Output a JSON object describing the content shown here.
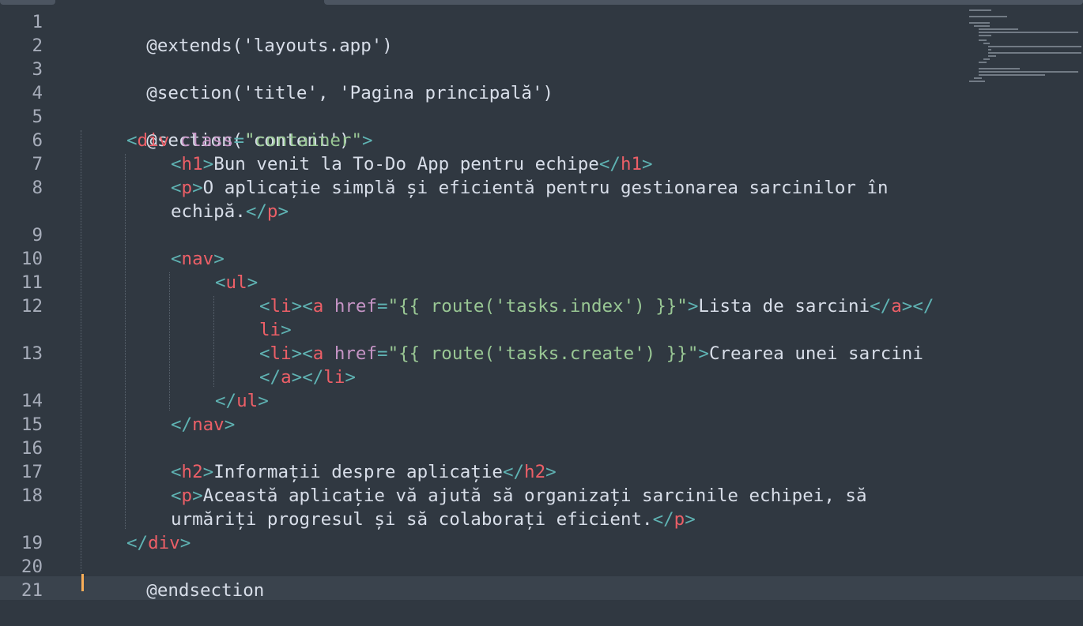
{
  "editor": {
    "line_numbers": [
      "1",
      "2",
      "3",
      "4",
      "5",
      "6",
      "7",
      "8",
      "9",
      "10",
      "11",
      "12",
      "13",
      "14",
      "15",
      "16",
      "17",
      "18",
      "19",
      "20",
      "21"
    ],
    "code": {
      "l1": "@extends('layouts.app')",
      "l3": "@section('title', 'Pagina principală')",
      "l5": "@section('content')",
      "l20": "@endsection"
    },
    "tokens": {
      "lt": "<",
      "gt": ">",
      "lt_slash": "</",
      "eq": "=",
      "div": "div",
      "class": "class",
      "container": "\"container\"",
      "h1": "h1",
      "h1_text": "Bun venit la To-Do App pentru echipe",
      "p": "p",
      "p1_text_a": "O aplicație simplă și eficientă pentru gestionarea sarcinilor în",
      "p1_text_b": "echipă.",
      "nav": "nav",
      "ul": "ul",
      "li": "li",
      "a": "a",
      "href": "href",
      "href_index": "\"{{ route('tasks.index') }}\"",
      "link_index_text": "Lista de sarcini",
      "li_part": "li",
      "href_create": "\"{{ route('tasks.create') }}\"",
      "link_create_text": "Crearea unei sarcini",
      "h2": "h2",
      "h2_text": "Informații despre aplicație",
      "p2_text_a": "Această aplicație vă ajută să organizați sarcinile echipei, să",
      "p2_text_b": "urmăriți progresul și să colaborați eficient."
    }
  },
  "colors": {
    "background": "#303841",
    "tag": "#ec5f67",
    "bracket": "#5fb3b3",
    "attribute": "#c594c5",
    "string": "#99c794",
    "text": "#d8dee9",
    "line_number": "#a7adba",
    "cursor": "#f9ae58"
  }
}
